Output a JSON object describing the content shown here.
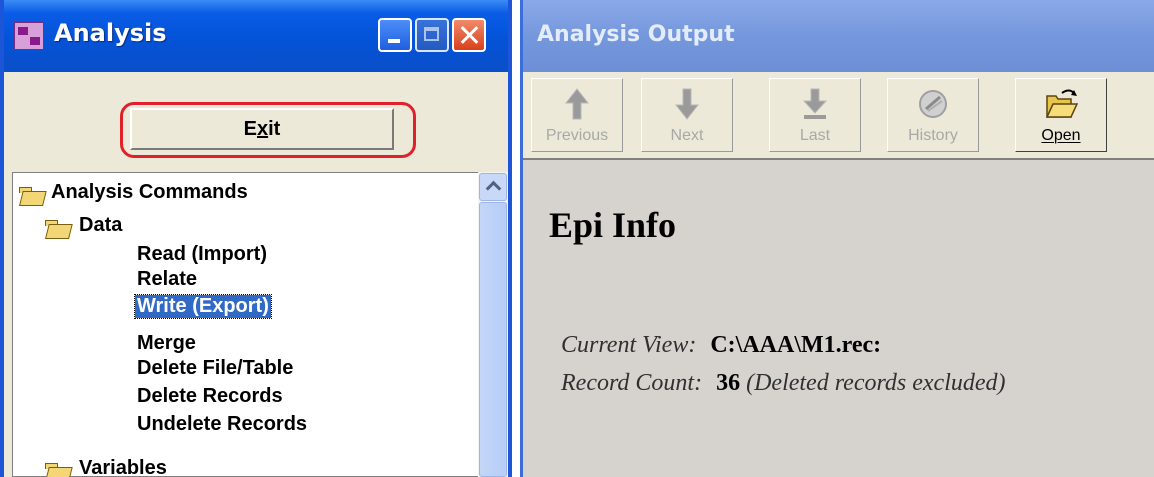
{
  "left_window": {
    "title": "Analysis",
    "exit_button": {
      "prefix": "E",
      "accel": "x",
      "suffix": "it"
    },
    "tree": {
      "root": "Analysis Commands",
      "data_folder": "Data",
      "data_items": [
        "Read (Import)",
        "Relate",
        "Write (Export)",
        "Merge",
        "Delete File/Table",
        "Delete Records",
        "Undelete Records"
      ],
      "selected_item": "Write (Export)",
      "variables_folder": "Variables"
    }
  },
  "right_window": {
    "title": "Analysis Output",
    "toolbar": [
      {
        "label": "Previous",
        "icon": "up-arrow-icon",
        "enabled": false
      },
      {
        "label": "Next",
        "icon": "down-arrow-icon",
        "enabled": false
      },
      {
        "label": "Last",
        "icon": "last-arrow-icon",
        "enabled": false
      },
      {
        "label": "History",
        "icon": "history-icon",
        "enabled": false
      },
      {
        "label": "Open",
        "icon": "open-folder-icon",
        "enabled": true
      }
    ],
    "output": {
      "heading": "Epi Info",
      "current_view_label": "Current View:",
      "current_view_value": "C:\\AAA\\M1.rec:",
      "record_count_label": "Record Count:",
      "record_count_value": "36",
      "record_count_note": "(Deleted records excluded)"
    }
  },
  "colors": {
    "title_bar": "#0453d8",
    "selection": "#316ac5",
    "highlight_ring": "#e0202a",
    "inactive_title": "#7597dc"
  }
}
